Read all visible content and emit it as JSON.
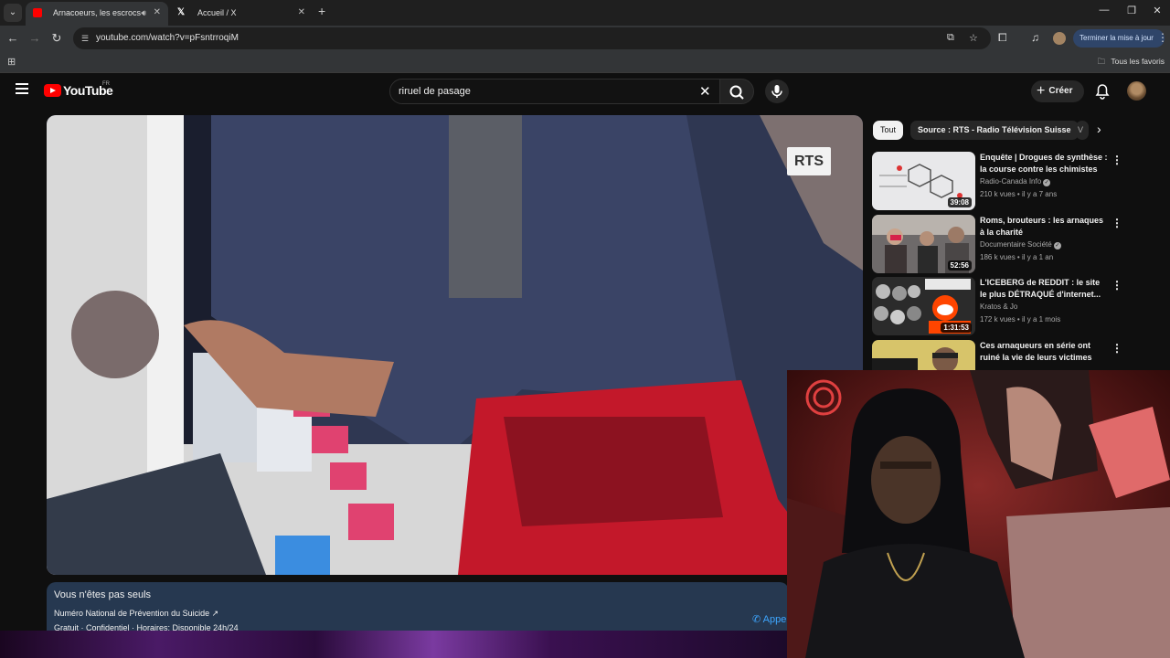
{
  "browser": {
    "tabs": [
      {
        "title": "Arnacoeurs, les escrocs de l'amour",
        "favicon": "youtube-icon",
        "active": true,
        "audio": true
      },
      {
        "title": "Accueil / X",
        "favicon": "x-icon",
        "active": false
      }
    ],
    "url": "youtube.com/watch?v=pFsntrroqiM",
    "update_button": "Terminer la mise à jour",
    "bookmarks_label": "Tous les favoris"
  },
  "youtube": {
    "logo_text": "YouTube",
    "country_code": "FR",
    "search_value": "riruel de pasage",
    "create_label": "Créer"
  },
  "player": {
    "channel_logo": "RTS"
  },
  "crisis_panel": {
    "title": "Vous n'êtes pas seuls",
    "line_name": "Numéro National de Prévention du Suicide ↗",
    "info": "Gratuit · Confidentiel · Horaires: Disponible 24h/24",
    "call_label": "Appeler"
  },
  "sidebar": {
    "chips": [
      "Tout",
      "Source : RTS - Radio Télévision Suisse",
      "V"
    ],
    "recommendations": [
      {
        "title": "Enquête | Drogues de synthèse : la course contre les chimistes",
        "channel": "Radio-Canada Info",
        "verified": true,
        "views": "210 k vues",
        "age": "il y a 7 ans",
        "duration": "39:08"
      },
      {
        "title": "Roms, brouteurs : les arnaques à la charité",
        "channel": "Documentaire Société",
        "verified": true,
        "views": "186 k vues",
        "age": "il y a 1 an",
        "duration": "52:56"
      },
      {
        "title": "L'ICEBERG de REDDIT : le site le plus DÉTRAQUÉ d'internet...",
        "channel": "Kratos & Jo",
        "verified": false,
        "views": "172 k vues",
        "age": "il y a 1 mois",
        "duration": "1:31:53"
      },
      {
        "title": "Ces arnaqueurs en série ont ruiné la vie de leurs victimes",
        "channel": "",
        "verified": false,
        "views": "",
        "age": "",
        "duration": ""
      }
    ]
  },
  "colors": {
    "yt_red": "#ff0000",
    "background": "#0f0f0f",
    "crisis_bg": "#263850",
    "link_blue": "#3ea6ff"
  }
}
